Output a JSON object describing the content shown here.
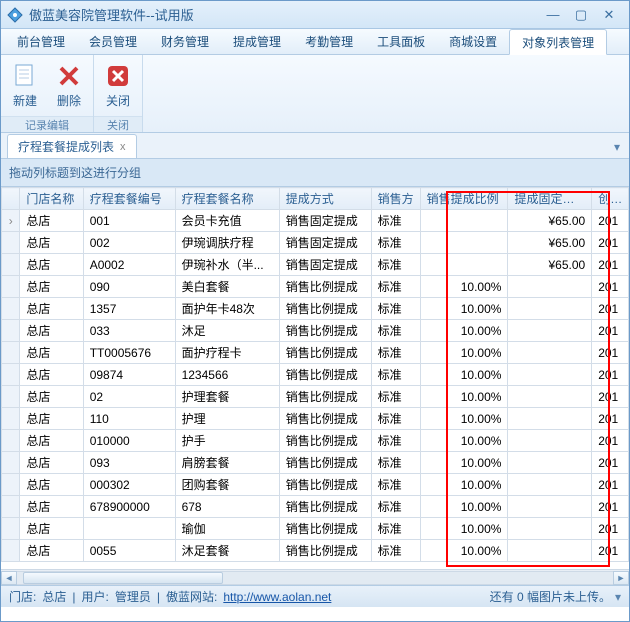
{
  "window": {
    "title": "傲蓝美容院管理软件--试用版"
  },
  "menu": {
    "items": [
      "前台管理",
      "会员管理",
      "财务管理",
      "提成管理",
      "考勤管理",
      "工具面板",
      "商城设置",
      "对象列表管理"
    ],
    "active": 7
  },
  "ribbon": {
    "group1": {
      "caption": "记录编辑",
      "btn_new": "新建",
      "btn_delete": "删除"
    },
    "group2": {
      "caption": "关闭",
      "btn_close": "关闭"
    }
  },
  "tab": {
    "label": "疗程套餐提成列表",
    "close": "x",
    "dropdown": "▾"
  },
  "group_panel": "拖动列标题到这进行分组",
  "columns": [
    "门店名称",
    "疗程套餐编号",
    "疗程套餐名称",
    "提成方式",
    "销售方",
    "销售提成比例",
    "提成固定金额",
    "创建"
  ],
  "rows": [
    {
      "store": "总店",
      "code": "001",
      "name": "会员卡充值",
      "method": "销售固定提成",
      "sale": "标准",
      "pct": "",
      "fixed": "¥65.00",
      "extra": "201"
    },
    {
      "store": "总店",
      "code": "002",
      "name": "伊琬调肤疗程",
      "method": "销售固定提成",
      "sale": "标准",
      "pct": "",
      "fixed": "¥65.00",
      "extra": "201"
    },
    {
      "store": "总店",
      "code": "A0002",
      "name": "伊琬补水（半...",
      "method": "销售固定提成",
      "sale": "标准",
      "pct": "",
      "fixed": "¥65.00",
      "extra": "201"
    },
    {
      "store": "总店",
      "code": "090",
      "name": "美白套餐",
      "method": "销售比例提成",
      "sale": "标准",
      "pct": "10.00%",
      "fixed": "",
      "extra": "201"
    },
    {
      "store": "总店",
      "code": "1357",
      "name": "面护年卡48次",
      "method": "销售比例提成",
      "sale": "标准",
      "pct": "10.00%",
      "fixed": "",
      "extra": "201"
    },
    {
      "store": "总店",
      "code": "033",
      "name": "沐足",
      "method": "销售比例提成",
      "sale": "标准",
      "pct": "10.00%",
      "fixed": "",
      "extra": "201"
    },
    {
      "store": "总店",
      "code": "TT0005676",
      "name": "面护疗程卡",
      "method": "销售比例提成",
      "sale": "标准",
      "pct": "10.00%",
      "fixed": "",
      "extra": "201"
    },
    {
      "store": "总店",
      "code": "09874",
      "name": "1234566",
      "method": "销售比例提成",
      "sale": "标准",
      "pct": "10.00%",
      "fixed": "",
      "extra": "201"
    },
    {
      "store": "总店",
      "code": "02",
      "name": "护理套餐",
      "method": "销售比例提成",
      "sale": "标准",
      "pct": "10.00%",
      "fixed": "",
      "extra": "201"
    },
    {
      "store": "总店",
      "code": "110",
      "name": "护理",
      "method": "销售比例提成",
      "sale": "标准",
      "pct": "10.00%",
      "fixed": "",
      "extra": "201"
    },
    {
      "store": "总店",
      "code": "010000",
      "name": "护手",
      "method": "销售比例提成",
      "sale": "标准",
      "pct": "10.00%",
      "fixed": "",
      "extra": "201"
    },
    {
      "store": "总店",
      "code": "093",
      "name": "肩膀套餐",
      "method": "销售比例提成",
      "sale": "标准",
      "pct": "10.00%",
      "fixed": "",
      "extra": "201"
    },
    {
      "store": "总店",
      "code": "000302",
      "name": "团购套餐",
      "method": "销售比例提成",
      "sale": "标准",
      "pct": "10.00%",
      "fixed": "",
      "extra": "201"
    },
    {
      "store": "总店",
      "code": "678900000",
      "name": " 678",
      "method": "销售比例提成",
      "sale": "标准",
      "pct": "10.00%",
      "fixed": "",
      "extra": "201"
    },
    {
      "store": "总店",
      "code": "",
      "name": "瑜伽",
      "method": "销售比例提成",
      "sale": "标准",
      "pct": "10.00%",
      "fixed": "",
      "extra": "201"
    },
    {
      "store": "总店",
      "code": "0055",
      "name": "沐足套餐",
      "method": "销售比例提成",
      "sale": "标准",
      "pct": "10.00%",
      "fixed": "",
      "extra": "201"
    }
  ],
  "statusbar": {
    "store_label": "门店:",
    "store_value": "总店",
    "user_label": "用户:",
    "user_value": "管理员",
    "site_label": "傲蓝网站:",
    "site_url": "http://www.aolan.net",
    "upload_msg": "还有 0 幅图片未上传。"
  }
}
